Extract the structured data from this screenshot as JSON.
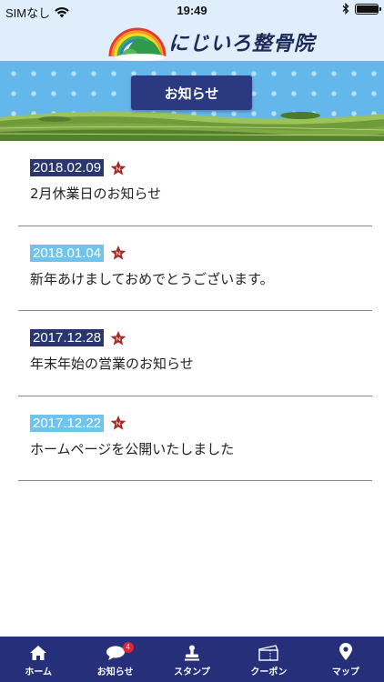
{
  "status_bar": {
    "carrier": "SIMなし",
    "time": "19:49",
    "battery_level": 0.95
  },
  "header": {
    "brand": "にじいろ整骨院"
  },
  "page": {
    "title": "お知らせ"
  },
  "news": [
    {
      "date": "2018.02.09",
      "badge_style": "dark",
      "title": "2月休業日のお知らせ"
    },
    {
      "date": "2018.01.04",
      "badge_style": "light",
      "title": "新年あけましておめでとうございます。"
    },
    {
      "date": "2017.12.28",
      "badge_style": "dark",
      "title": "年末年始の営業のお知らせ"
    },
    {
      "date": "2017.12.22",
      "badge_style": "light",
      "title": "ホームページを公開いたしました"
    }
  ],
  "tabs": [
    {
      "label": "ホーム",
      "icon": "home-icon"
    },
    {
      "label": "お知らせ",
      "icon": "speech-bubble-icon",
      "badge": "4"
    },
    {
      "label": "スタンプ",
      "icon": "stamp-icon"
    },
    {
      "label": "クーポン",
      "icon": "coupon-icon"
    },
    {
      "label": "マップ",
      "icon": "map-pin-icon"
    }
  ],
  "colors": {
    "navy": "#26307a",
    "date_dark": "#2b3670",
    "date_light": "#6fc4ef",
    "sky": "#64b7ea",
    "star_red": "#a52a2a",
    "badge_red": "#d8263a"
  }
}
